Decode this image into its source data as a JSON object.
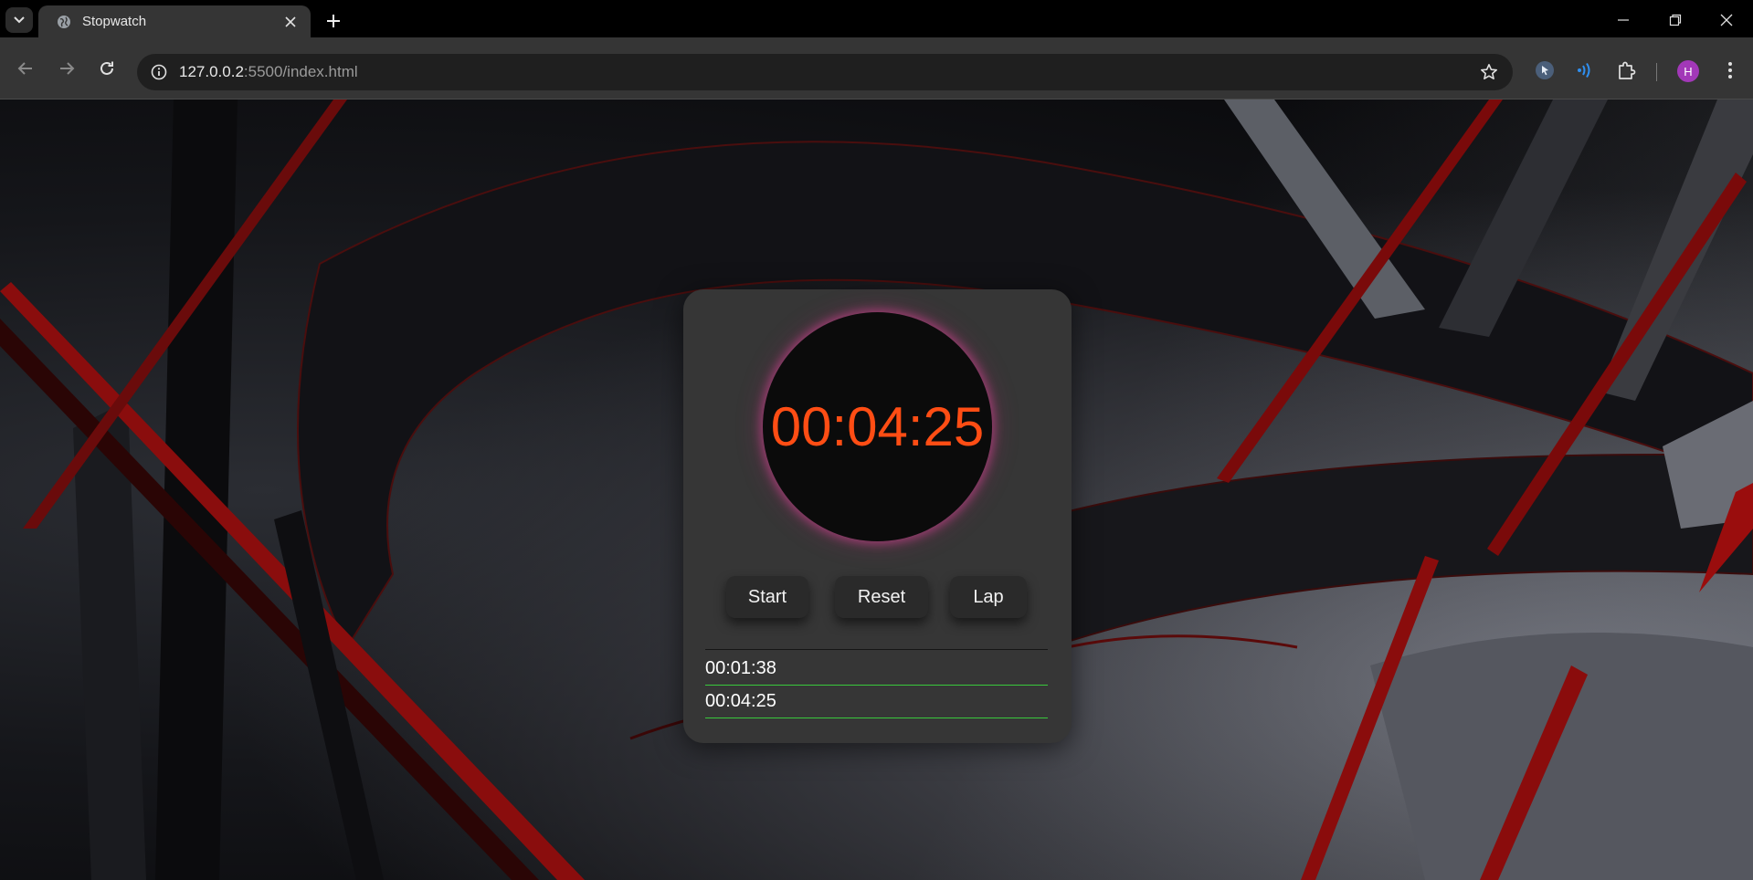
{
  "browser": {
    "tab_title": "Stopwatch",
    "url_host": "127.0.0.2",
    "url_rest": ":5500/index.html",
    "avatar_letter": "H",
    "icons": {
      "tab_search": "chevron-down-icon",
      "favicon": "globe-icon",
      "tab_close": "close-icon",
      "new_tab": "plus-icon",
      "minimize": "minimize-icon",
      "restore": "restore-icon",
      "window_close": "close-icon",
      "back": "arrow-left-icon",
      "forward": "arrow-right-icon",
      "reload": "reload-icon",
      "site_info": "info-icon",
      "bookmark": "star-icon",
      "extension_1": "cursor-extension-icon",
      "extension_2": "audio-wave-icon",
      "extensions": "puzzle-icon",
      "menu": "kebab-menu-icon"
    }
  },
  "stopwatch": {
    "display_time": "00:04:25",
    "time_color": "#ff4d14",
    "glow_color": "#d64696",
    "buttons": {
      "start": "Start",
      "reset": "Reset",
      "lap": "Lap"
    },
    "laps": [
      "00:01:38",
      "00:04:25"
    ],
    "lap_rule_color": "#39c93c"
  }
}
